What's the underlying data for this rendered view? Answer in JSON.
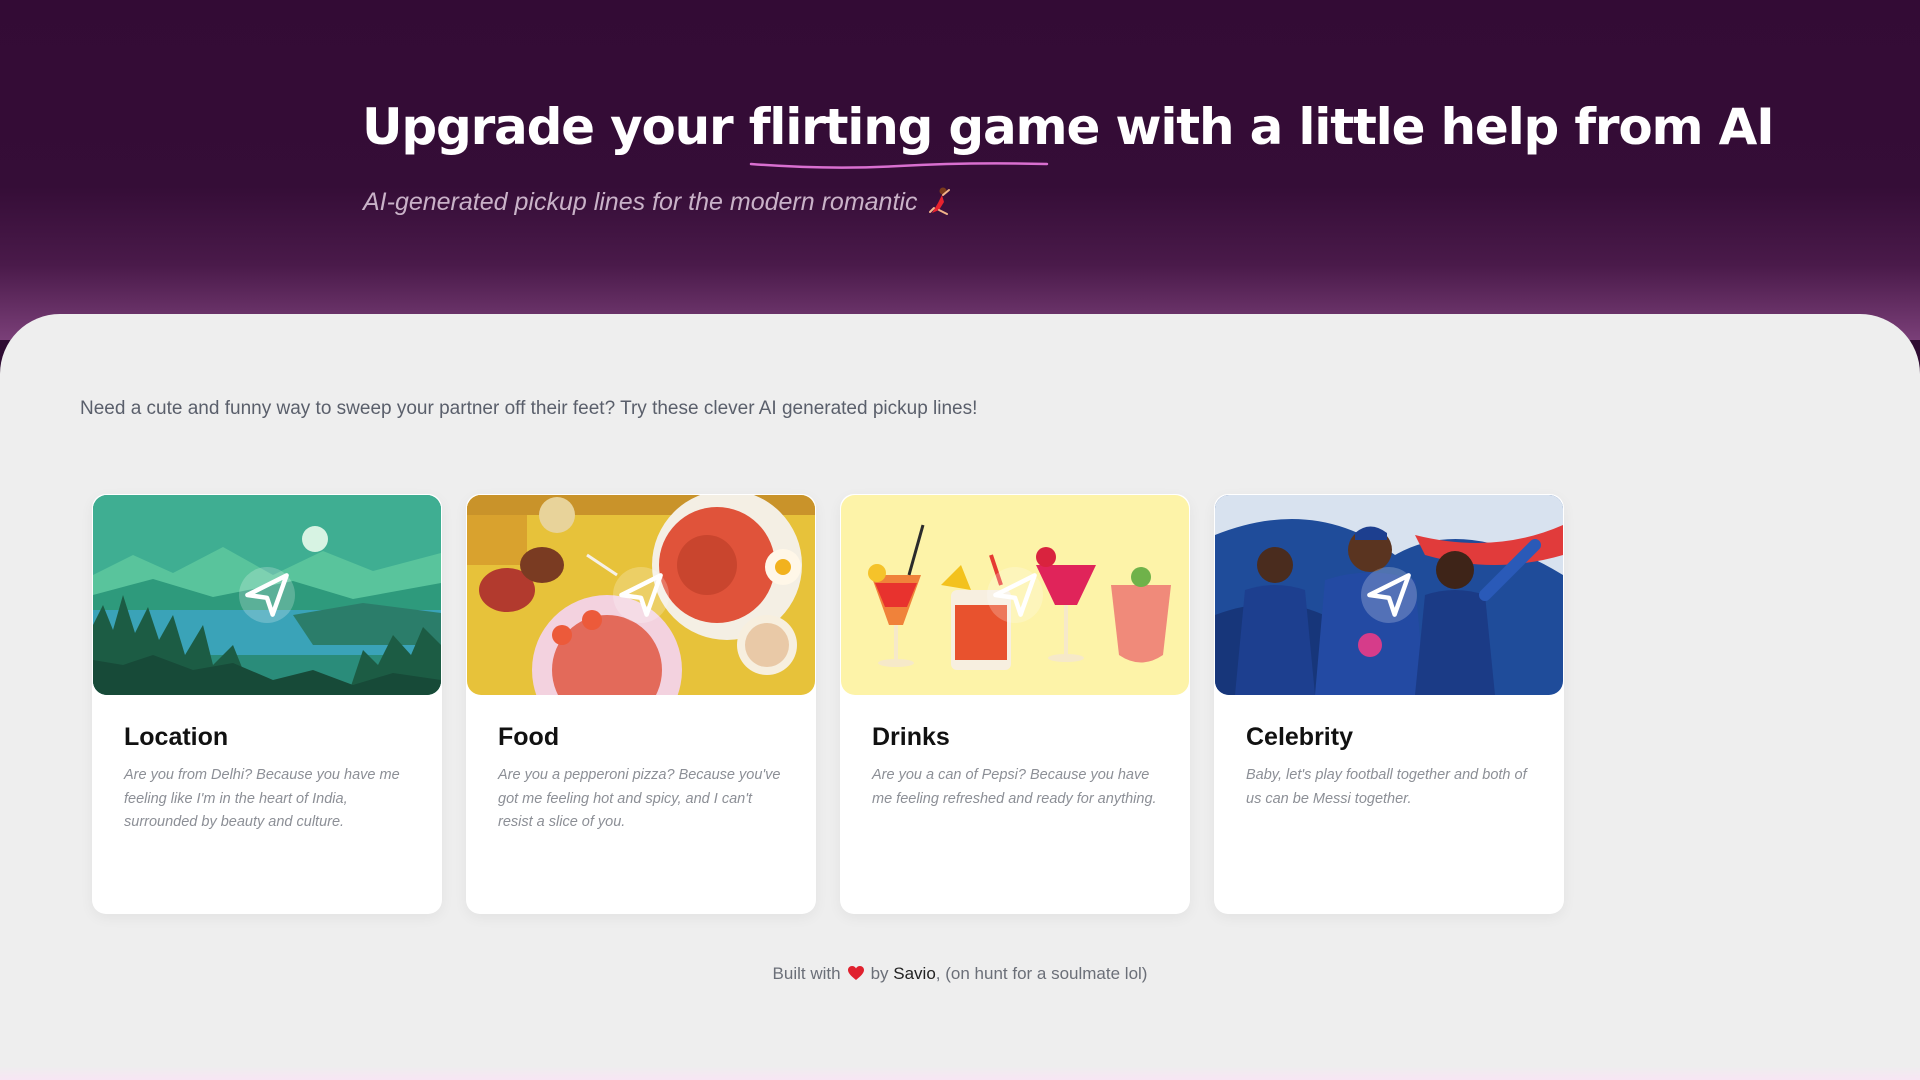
{
  "hero": {
    "title_before": "Upgrade your ",
    "title_highlight": "flirting game",
    "title_after": " with a little help from AI",
    "subtitle": "AI-generated pickup lines for the modern romantic"
  },
  "intro": "Need a cute and funny way to sweep your partner off their feet? Try these clever AI generated pickup lines!",
  "cards": [
    {
      "title": "Location",
      "text": "Are you from Delhi? Because you have me feeling like I'm in the heart of India, surrounded by beauty and culture.",
      "image": "mountain-lake-illustration"
    },
    {
      "title": "Food",
      "text": "Are you a pepperoni pizza? Because you've got me feeling hot and spicy, and I can't resist a slice of you.",
      "image": "food-platter-illustration"
    },
    {
      "title": "Drinks",
      "text": "Are you a can of Pepsi? Because you have me feeling refreshed and ready for anything.",
      "image": "cocktails-illustration"
    },
    {
      "title": "Celebrity",
      "text": "Baby, let's play football together and both of us can be Messi together.",
      "image": "cricket-players-illustration"
    }
  ],
  "footer": {
    "prefix": "Built with",
    "by": "by",
    "author": "Savio",
    "suffix": ", (on hunt for a soulmate lol)"
  },
  "colors": {
    "hero_bg": "#350d37",
    "panel_bg": "#eeeeee",
    "accent_underline": "#d96fd0",
    "heart": "#e0212e"
  }
}
